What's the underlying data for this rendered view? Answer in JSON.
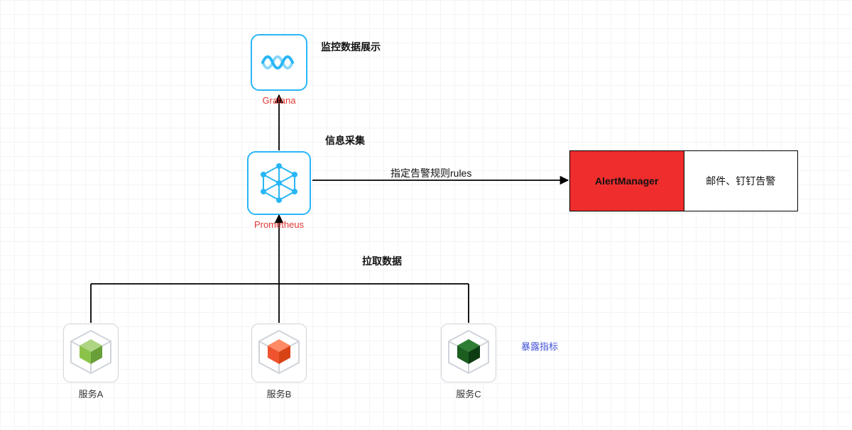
{
  "nodes": {
    "grafana": {
      "label": "Grafana",
      "desc": "监控数据展示"
    },
    "prometheus": {
      "label": "Prometheus",
      "desc": "信息采集"
    },
    "alertmanager": {
      "left": "AlertManager",
      "right": "邮件、钉钉告警"
    }
  },
  "edges": {
    "rules": "指定告警规则rules",
    "pull": "拉取数据"
  },
  "services": {
    "a": "服务A",
    "b": "服务B",
    "c": "服务C"
  },
  "expose": "暴露指标",
  "colors": {
    "svcA": "#8bc34a",
    "svcB": "#ef5330",
    "svcC": "#1b5e20",
    "nodeBorder": "#29b6f6",
    "alert": "#ef2d2d"
  }
}
